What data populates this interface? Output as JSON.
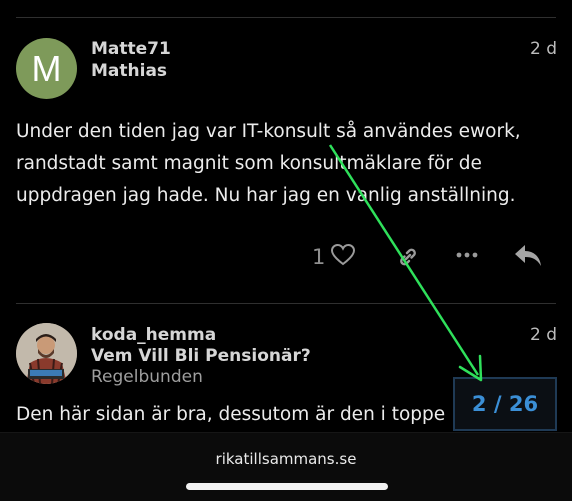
{
  "post1": {
    "avatar_letter": "M",
    "username": "Matte71",
    "fullname": "Mathias",
    "date": "2 d",
    "body": "Under den tiden jag var IT-konsult så användes ework, randstadt samt magnit som konsultmäklare för de uppdragen jag hade. Nu har jag en vanlig anställning.",
    "like_count": "1"
  },
  "post2": {
    "username": "koda_hemma",
    "title": "Vem Vill Bli Pensionär?",
    "group": "Regelbunden",
    "date": "2 d",
    "body": "Den här sidan är bra, dessutom är den i toppe"
  },
  "progress": {
    "label": "2 / 26"
  },
  "footer": {
    "site": "rikatillsammans.se"
  },
  "colors": {
    "accent": "#3b8fd6",
    "avatar_m": "#7e9a5a",
    "arrow": "#2fe05b"
  },
  "icons": [
    "heart-icon",
    "link-icon",
    "more-icon",
    "reply-icon",
    "arrow-annotation"
  ]
}
